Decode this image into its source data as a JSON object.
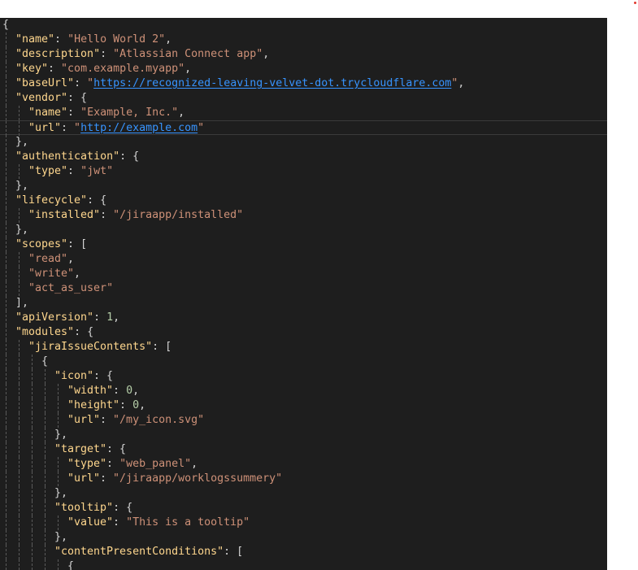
{
  "editor": {
    "lines": [
      {
        "indent": 0,
        "tokens": [
          {
            "t": "p",
            "v": "{"
          }
        ]
      },
      {
        "indent": 1,
        "tokens": [
          {
            "t": "k",
            "v": "\"name\""
          },
          {
            "t": "p",
            "v": ": "
          },
          {
            "t": "s",
            "v": "\"Hello World 2\""
          },
          {
            "t": "p",
            "v": ","
          }
        ]
      },
      {
        "indent": 1,
        "tokens": [
          {
            "t": "k",
            "v": "\"description\""
          },
          {
            "t": "p",
            "v": ": "
          },
          {
            "t": "s",
            "v": "\"Atlassian Connect app\""
          },
          {
            "t": "p",
            "v": ","
          }
        ]
      },
      {
        "indent": 1,
        "tokens": [
          {
            "t": "k",
            "v": "\"key\""
          },
          {
            "t": "p",
            "v": ": "
          },
          {
            "t": "s",
            "v": "\"com.example.myapp\""
          },
          {
            "t": "p",
            "v": ","
          }
        ]
      },
      {
        "indent": 1,
        "tokens": [
          {
            "t": "k",
            "v": "\"baseUrl\""
          },
          {
            "t": "p",
            "v": ": "
          },
          {
            "t": "s",
            "v": "\""
          },
          {
            "t": "u",
            "v": "https://recognized-leaving-velvet-dot.trycloudflare.com"
          },
          {
            "t": "s",
            "v": "\""
          },
          {
            "t": "p",
            "v": ","
          }
        ]
      },
      {
        "indent": 1,
        "tokens": [
          {
            "t": "k",
            "v": "\"vendor\""
          },
          {
            "t": "p",
            "v": ": {"
          }
        ]
      },
      {
        "indent": 2,
        "tokens": [
          {
            "t": "k",
            "v": "\"name\""
          },
          {
            "t": "p",
            "v": ": "
          },
          {
            "t": "s",
            "v": "\"Example, Inc.\""
          },
          {
            "t": "p",
            "v": ","
          }
        ]
      },
      {
        "indent": 2,
        "current": true,
        "tokens": [
          {
            "t": "k",
            "v": "\"url\""
          },
          {
            "t": "p",
            "v": ": "
          },
          {
            "t": "s",
            "v": "\""
          },
          {
            "t": "u",
            "v": "http://example.com"
          },
          {
            "t": "s",
            "v": "\""
          }
        ]
      },
      {
        "indent": 1,
        "tokens": [
          {
            "t": "p",
            "v": "},"
          }
        ]
      },
      {
        "indent": 1,
        "tokens": [
          {
            "t": "k",
            "v": "\"authentication\""
          },
          {
            "t": "p",
            "v": ": {"
          }
        ]
      },
      {
        "indent": 2,
        "tokens": [
          {
            "t": "k",
            "v": "\"type\""
          },
          {
            "t": "p",
            "v": ": "
          },
          {
            "t": "s",
            "v": "\"jwt\""
          }
        ]
      },
      {
        "indent": 1,
        "tokens": [
          {
            "t": "p",
            "v": "},"
          }
        ]
      },
      {
        "indent": 1,
        "tokens": [
          {
            "t": "k",
            "v": "\"lifecycle\""
          },
          {
            "t": "p",
            "v": ": {"
          }
        ]
      },
      {
        "indent": 2,
        "tokens": [
          {
            "t": "k",
            "v": "\"installed\""
          },
          {
            "t": "p",
            "v": ": "
          },
          {
            "t": "s",
            "v": "\"/jiraapp/installed\""
          }
        ]
      },
      {
        "indent": 1,
        "tokens": [
          {
            "t": "p",
            "v": "},"
          }
        ]
      },
      {
        "indent": 1,
        "tokens": [
          {
            "t": "k",
            "v": "\"scopes\""
          },
          {
            "t": "p",
            "v": ": ["
          }
        ]
      },
      {
        "indent": 2,
        "tokens": [
          {
            "t": "s",
            "v": "\"read\""
          },
          {
            "t": "p",
            "v": ","
          }
        ]
      },
      {
        "indent": 2,
        "tokens": [
          {
            "t": "s",
            "v": "\"write\""
          },
          {
            "t": "p",
            "v": ","
          }
        ]
      },
      {
        "indent": 2,
        "tokens": [
          {
            "t": "s",
            "v": "\"act_as_user\""
          }
        ]
      },
      {
        "indent": 1,
        "tokens": [
          {
            "t": "p",
            "v": "],"
          }
        ]
      },
      {
        "indent": 1,
        "tokens": [
          {
            "t": "k",
            "v": "\"apiVersion\""
          },
          {
            "t": "p",
            "v": ": "
          },
          {
            "t": "n",
            "v": "1"
          },
          {
            "t": "p",
            "v": ","
          }
        ]
      },
      {
        "indent": 1,
        "tokens": [
          {
            "t": "k",
            "v": "\"modules\""
          },
          {
            "t": "p",
            "v": ": {"
          }
        ]
      },
      {
        "indent": 2,
        "tokens": [
          {
            "t": "k",
            "v": "\"jiraIssueContents\""
          },
          {
            "t": "p",
            "v": ": ["
          }
        ]
      },
      {
        "indent": 3,
        "tokens": [
          {
            "t": "p",
            "v": "{"
          }
        ]
      },
      {
        "indent": 4,
        "tokens": [
          {
            "t": "k",
            "v": "\"icon\""
          },
          {
            "t": "p",
            "v": ": {"
          }
        ]
      },
      {
        "indent": 5,
        "tokens": [
          {
            "t": "k",
            "v": "\"width\""
          },
          {
            "t": "p",
            "v": ": "
          },
          {
            "t": "n",
            "v": "0"
          },
          {
            "t": "p",
            "v": ","
          }
        ]
      },
      {
        "indent": 5,
        "tokens": [
          {
            "t": "k",
            "v": "\"height\""
          },
          {
            "t": "p",
            "v": ": "
          },
          {
            "t": "n",
            "v": "0"
          },
          {
            "t": "p",
            "v": ","
          }
        ]
      },
      {
        "indent": 5,
        "tokens": [
          {
            "t": "k",
            "v": "\"url\""
          },
          {
            "t": "p",
            "v": ": "
          },
          {
            "t": "s",
            "v": "\"/my_icon.svg\""
          }
        ]
      },
      {
        "indent": 4,
        "tokens": [
          {
            "t": "p",
            "v": "},"
          }
        ]
      },
      {
        "indent": 4,
        "tokens": [
          {
            "t": "k",
            "v": "\"target\""
          },
          {
            "t": "p",
            "v": ": {"
          }
        ]
      },
      {
        "indent": 5,
        "tokens": [
          {
            "t": "k",
            "v": "\"type\""
          },
          {
            "t": "p",
            "v": ": "
          },
          {
            "t": "s",
            "v": "\"web_panel\""
          },
          {
            "t": "p",
            "v": ","
          }
        ]
      },
      {
        "indent": 5,
        "tokens": [
          {
            "t": "k",
            "v": "\"url\""
          },
          {
            "t": "p",
            "v": ": "
          },
          {
            "t": "s",
            "v": "\"/jiraapp/worklogssummery\""
          }
        ]
      },
      {
        "indent": 4,
        "tokens": [
          {
            "t": "p",
            "v": "},"
          }
        ]
      },
      {
        "indent": 4,
        "tokens": [
          {
            "t": "k",
            "v": "\"tooltip\""
          },
          {
            "t": "p",
            "v": ": {"
          }
        ]
      },
      {
        "indent": 5,
        "tokens": [
          {
            "t": "k",
            "v": "\"value\""
          },
          {
            "t": "p",
            "v": ": "
          },
          {
            "t": "s",
            "v": "\"This is a tooltip\""
          }
        ]
      },
      {
        "indent": 4,
        "tokens": [
          {
            "t": "p",
            "v": "},"
          }
        ]
      },
      {
        "indent": 4,
        "tokens": [
          {
            "t": "k",
            "v": "\"contentPresentConditions\""
          },
          {
            "t": "p",
            "v": ": ["
          }
        ]
      },
      {
        "indent": 5,
        "tokens": [
          {
            "t": "p",
            "v": "{"
          }
        ]
      }
    ]
  },
  "colors": {
    "editor_background": "#1e1e1e",
    "key": "#ffd78e",
    "string": "#ce9178",
    "number": "#b5cea8",
    "punctuation": "#d4d4d4",
    "link": "#3794ff"
  }
}
